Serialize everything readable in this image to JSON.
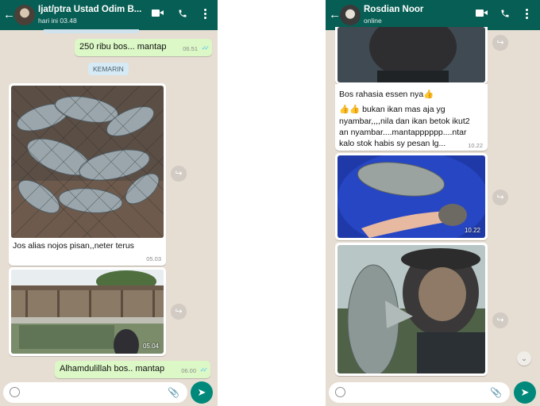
{
  "left_chat": {
    "title": "Ijat/ptra Ustad Odim B...",
    "subtitle": "hari ini 03.48",
    "messages": {
      "m1": {
        "text": "250 ribu bos... mantap",
        "time": "06.51",
        "ticks": "✓✓"
      },
      "date_chip": "KEMARIN",
      "m2": {
        "caption": "Jos alias nojos pisan,,neter terus",
        "time": "05.03",
        "image": "fish-in-net-photo"
      },
      "m3": {
        "time": "05.04",
        "image": "fish-pond-photo"
      },
      "m4": {
        "text": "Alhamdulillah bos.. mantap",
        "time": "06.00",
        "ticks": "✓✓"
      }
    },
    "input": {
      "emoji_icon": "emoji-icon",
      "attach_icon": "paperclip-icon",
      "send_icon": "send-icon"
    }
  },
  "right_chat": {
    "title": "Rosdian Noor",
    "subtitle": "online",
    "messages": {
      "r1": {
        "caption": "Bos rahasia essen nya👍"
      },
      "r2": {
        "line1": "👍👍 bukan ikan mas aja yg",
        "line2": "nyambar,,,,nila dan ikan betok ikut2",
        "line3": "an nyambar....mantapppppp....ntar",
        "line4": "kalo stok habis sy pesan lg...",
        "time": "10.22"
      },
      "r3": {
        "time": "10.22",
        "image": "fish-in-bucket-photo"
      },
      "r4": {
        "image": "man-holding-fish-photo"
      }
    },
    "input": {
      "emoji_icon": "emoji-icon",
      "attach_icon": "paperclip-icon",
      "send_icon": "send-icon"
    }
  },
  "colors": {
    "header": "#075e54",
    "chat_bg": "#e6ddd3",
    "outgoing": "#dcf8c6",
    "incoming": "#ffffff",
    "send": "#00897b",
    "ticks": "#4fc3f7"
  },
  "icons": {
    "back": "←",
    "share": "↪",
    "send": "➤",
    "clip": "📎",
    "scroll": "⌄"
  }
}
